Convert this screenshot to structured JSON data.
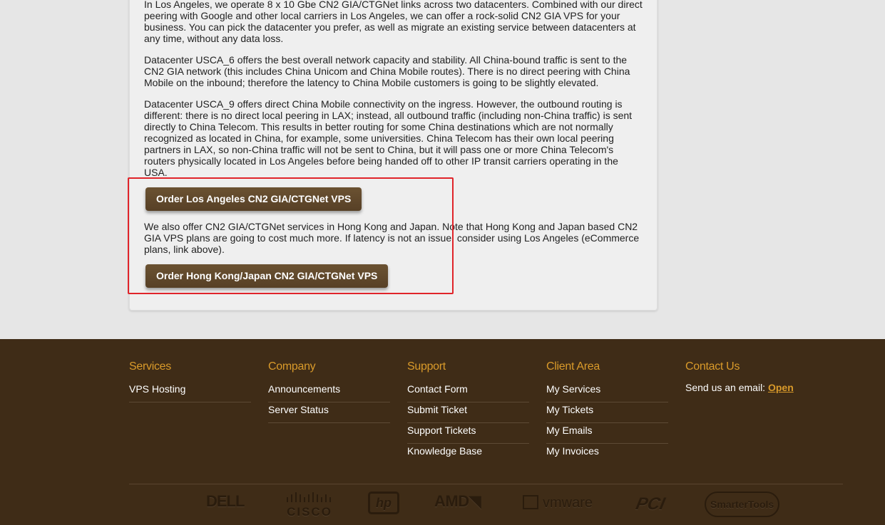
{
  "main": {
    "paragraphs": [
      "In Los Angeles, we operate 8 x 10 Gbe CN2 GIA/CTGNet links across two datacenters. Combined with our direct peering with Google and other local carriers in Los Angeles, we can offer a rock-solid CN2 GIA VPS for your business. You can pick the datacenter you prefer, as well as migrate an existing service between datacenters at any time, without any data loss.",
      "Datacenter USCA_6 offers the best overall network capacity and stability. All China-bound traffic is sent to the CN2 GIA network (this includes China Unicom and China Mobile routes). There is no direct peering with China Mobile on the inbound; therefore the latency to China Mobile customers is going to be slightly elevated.",
      "Datacenter USCA_9 offers direct China Mobile connectivity on the ingress. However, the outbound routing is different: there is no direct local peering in LAX; instead, all outbound traffic (including non-China traffic) is sent directly to China Telecom. This results in better routing for some China destinations which are not normally recognized as located in China, for example, some universities. China Telecom has their own local peering partners in LAX, so non-China traffic will not be sent to China, but it will pass one or more China Telecom's routers physically located in Los Angeles before being handed off to other IP transit carriers operating in the USA.",
      "We also offer CN2 GIA/CTGNet services in Hong Kong and Japan. Note that Hong Kong and Japan based CN2 GIA VPS plans are going to cost much more. If latency is not an issue, consider using Los Angeles (eCommerce plans, link above)."
    ],
    "btn_la": "Order Los Angeles CN2 GIA/CTGNet VPS",
    "btn_hk": "Order Hong Kong/Japan CN2 GIA/CTGNet VPS"
  },
  "footer": {
    "services": {
      "title": "Services",
      "links": [
        "VPS Hosting"
      ]
    },
    "company": {
      "title": "Company",
      "links": [
        "Announcements",
        "Server Status"
      ]
    },
    "support": {
      "title": "Support",
      "links": [
        "Contact Form",
        "Submit Ticket",
        "Support Tickets",
        "Knowledge Base"
      ]
    },
    "client": {
      "title": "Client Area",
      "links": [
        "My Services",
        "My Tickets",
        "My Emails",
        "My Invoices"
      ]
    },
    "contact": {
      "title": "Contact Us",
      "text": "Send us an email: ",
      "link": "Open"
    },
    "logos": [
      "DELL",
      "CISCO",
      "hp",
      "AMD",
      "vmware",
      "PCI",
      "SmarterTools"
    ]
  },
  "colors": {
    "footer_bg": "#3f2c17",
    "footer_title": "#d99a2a",
    "button_bg": "#5f4629",
    "highlight": "#e0242a"
  }
}
